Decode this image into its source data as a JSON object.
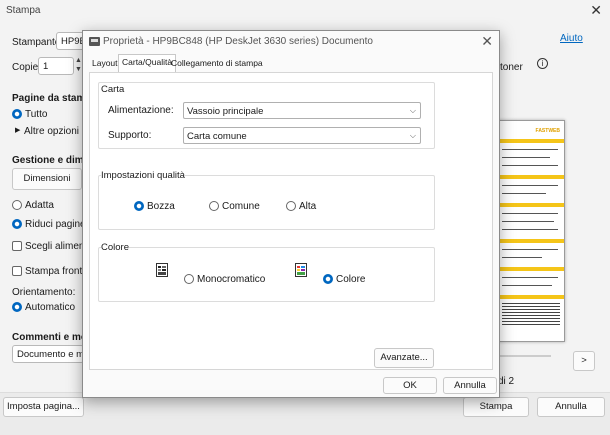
{
  "background": {
    "title": "Stampa",
    "printer_label": "Stampante:",
    "printer_value": "HP9BC",
    "help_link": "Aiuto",
    "copies_label": "Copie:",
    "copies_value": "1",
    "toner_label": "toner",
    "pages_heading": "Pagine da stampa",
    "radio_all": "Tutto",
    "other_options": "Altre opzioni",
    "sizing_heading": "Gestione e dimen",
    "dimensions_button": "Dimensioni",
    "adapt_label": "Adatta",
    "reduce_label": "Riduci pagine c",
    "choose_feed_label": "Scegli alimenta",
    "duplex_label": "Stampa fronte/",
    "orientation_label": "Orientamento:",
    "orientation_value": "Automatico",
    "comments_heading": "Commenti e mod",
    "comments_value": "Documento e ma",
    "page_count": "di 2",
    "next_button": ">",
    "page_setup_button": "Imposta pagina...",
    "print_button": "Stampa",
    "cancel_button": "Annulla",
    "preview_brand": "FASTWEB"
  },
  "dialog": {
    "title": "Proprietà - HP9BC848 (HP DeskJet 3630 series) Documento",
    "tabs": [
      "Layout",
      "Carta/Qualità",
      "Collegamento di stampa"
    ],
    "paper_group": "Carta",
    "source_label": "Alimentazione:",
    "source_value": "Vassoio principale",
    "media_label": "Supporto:",
    "media_value": "Carta comune",
    "quality_group": "Impostazioni qualità",
    "quality_options": [
      "Bozza",
      "Comune",
      "Alta"
    ],
    "color_group": "Colore",
    "mono_label": "Monocromatico",
    "color_label": "Colore",
    "advanced_button": "Avanzate...",
    "ok_button": "OK",
    "cancel_button": "Annulla"
  }
}
